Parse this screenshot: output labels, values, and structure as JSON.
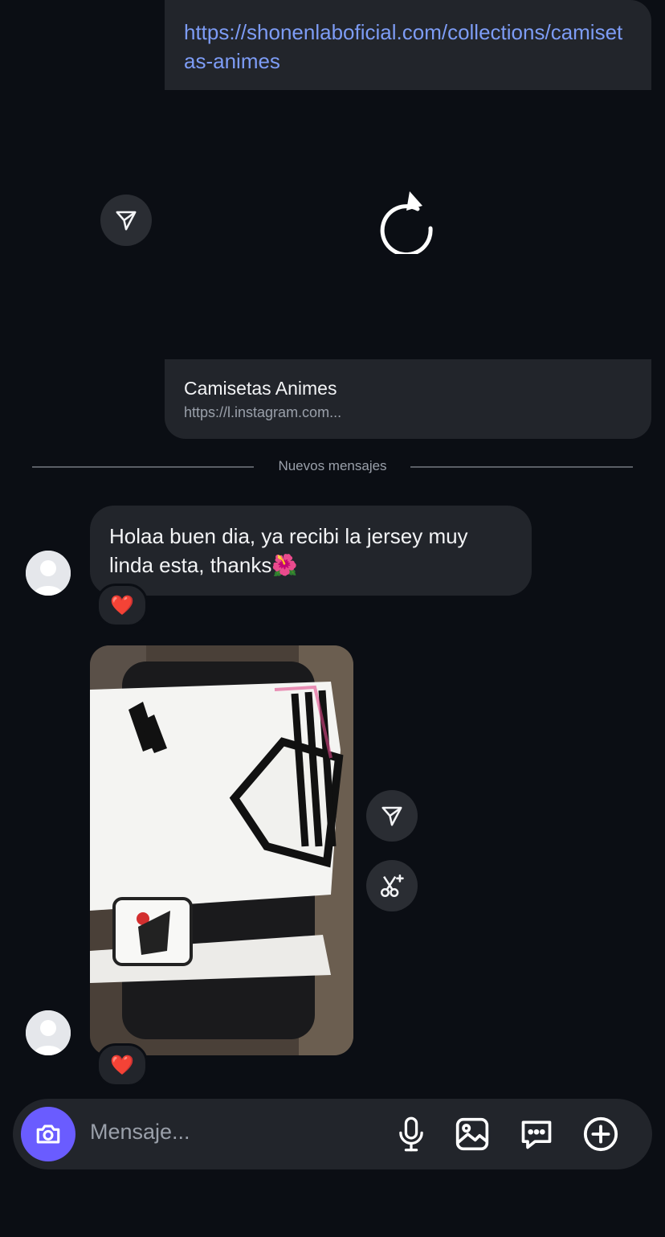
{
  "shared_link": {
    "url": "https://shonenlaboficial.com/collections/camisetas-animes",
    "card_title": "Camisetas Animes",
    "card_domain": "https://l.instagram.com..."
  },
  "divider": {
    "label": "Nuevos mensajes"
  },
  "messages": [
    {
      "type": "text",
      "text": "Holaa buen dia, ya recibi la jersey muy linda esta, thanks🌺",
      "reaction": "❤️"
    },
    {
      "type": "photo",
      "reaction": "❤️"
    }
  ],
  "composer": {
    "placeholder": "Mensaje..."
  },
  "colors": {
    "accent": "#6a5cff",
    "link": "#7d9cf5",
    "bubble": "#22252b",
    "background": "#0b0e14"
  },
  "icons": [
    "share-icon",
    "reload-icon",
    "camera-icon",
    "microphone-icon",
    "gallery-icon",
    "sticker-icon",
    "plus-icon",
    "ai-edit-icon",
    "heart-icon"
  ]
}
